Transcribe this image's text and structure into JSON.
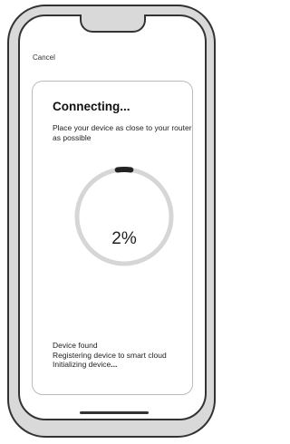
{
  "header": {
    "cancel_label": "Cancel"
  },
  "connecting": {
    "title": "Connecting",
    "title_suffix": "...",
    "subtitle": "Place your device as close to your router as possible"
  },
  "progress": {
    "percent_label": "2%",
    "value": 0.02
  },
  "status": {
    "lines": [
      "Device found",
      "Registering device to smart cloud"
    ],
    "last_line": "Initializing device",
    "last_suffix": "..."
  },
  "colors": {
    "track": "#d6d6d6",
    "arc": "#222222",
    "frame": "#333333",
    "frame_fill": "#d9d9d9"
  }
}
